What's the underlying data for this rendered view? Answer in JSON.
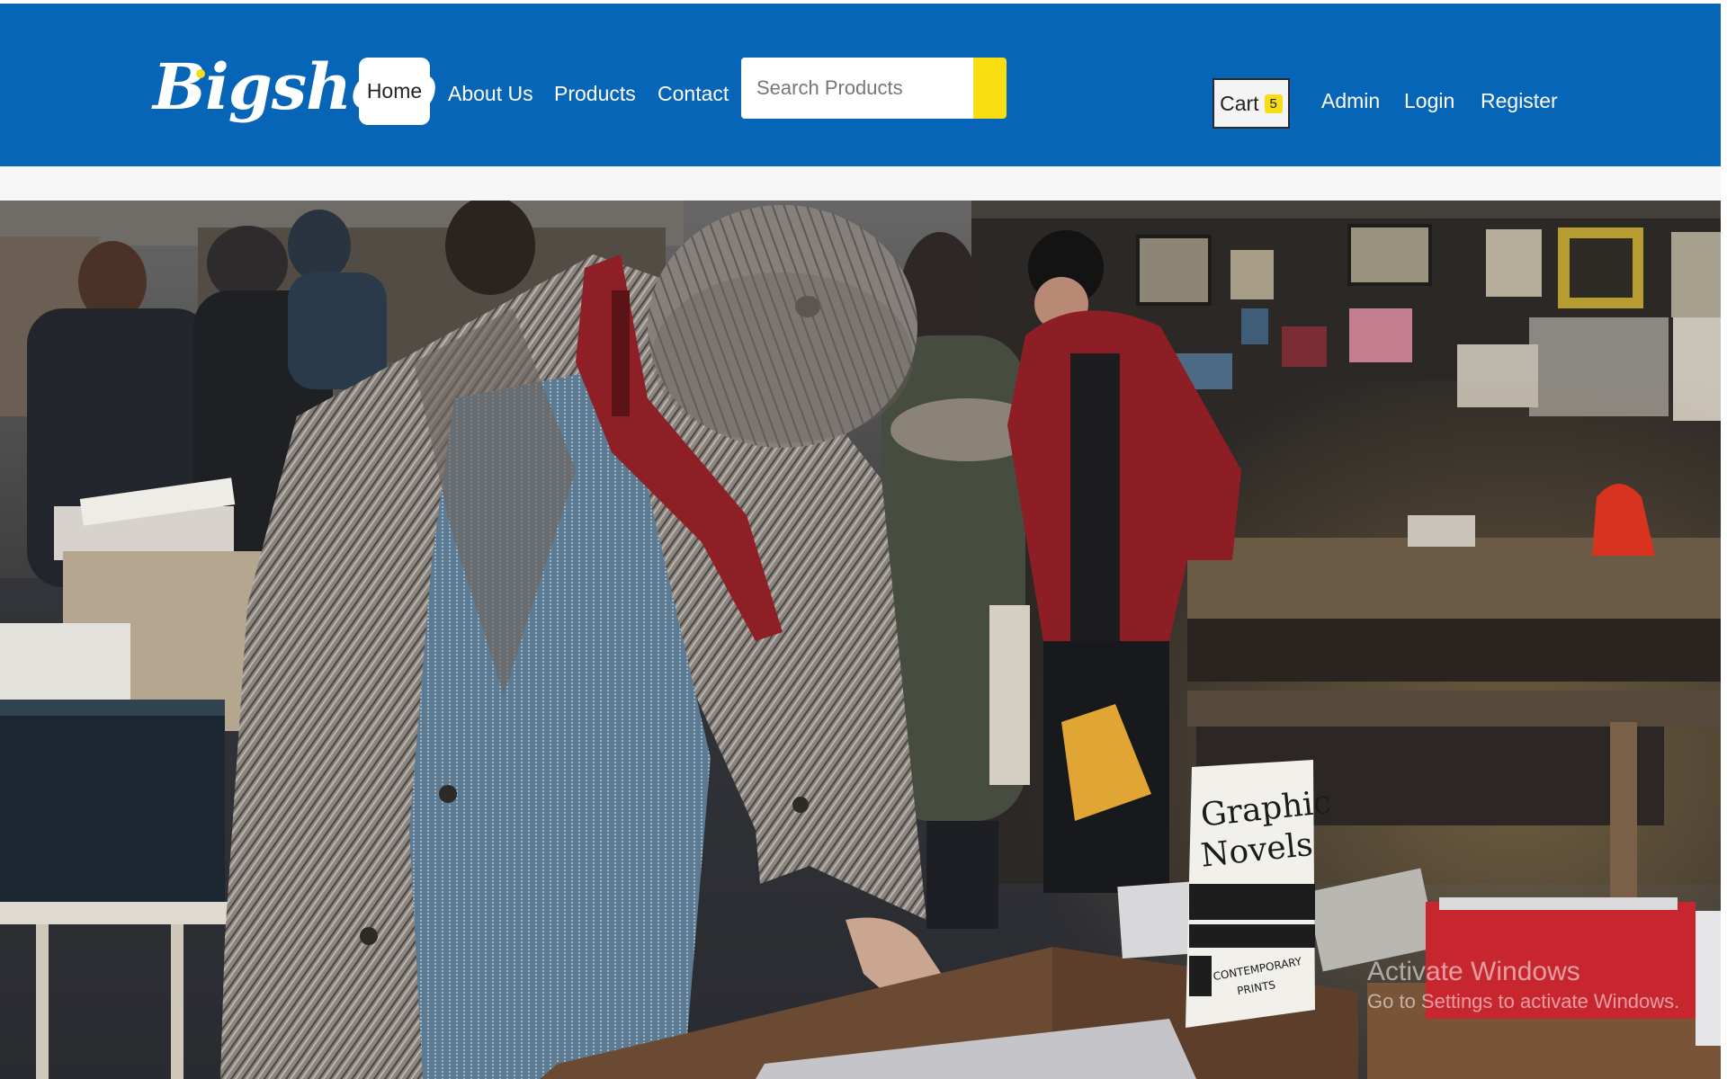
{
  "navbar": {
    "logo": "Bigshop",
    "links": {
      "home": "Home",
      "about": "About Us",
      "products": "Products",
      "contact": "Contact"
    },
    "search": {
      "placeholder": "Search Products"
    },
    "cart": {
      "label": "Cart",
      "count": "5"
    },
    "right_links": {
      "admin": "Admin",
      "login": "Login",
      "register": "Register"
    }
  },
  "hero": {
    "sign_text": [
      "Graphic",
      "Novels",
      "CONTEMPORARY",
      "PRINTS"
    ]
  },
  "watermark": {
    "title": "Activate Windows",
    "subtitle": "Go to Settings to activate Windows."
  },
  "colors": {
    "brand_blue": "#0665b6",
    "accent_yellow": "#f7dd12"
  },
  "icons": {
    "search_button": "search-icon"
  }
}
